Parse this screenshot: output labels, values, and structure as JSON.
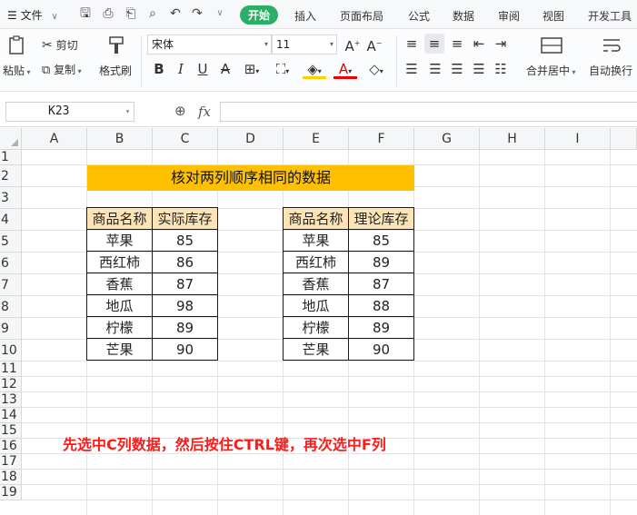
{
  "menubar": {
    "file_label": "文件",
    "tabs": [
      "开始",
      "插入",
      "页面布局",
      "公式",
      "数据",
      "审阅",
      "视图",
      "开发工具"
    ],
    "active_tab": "开始"
  },
  "ribbon": {
    "paste": "粘贴",
    "cut": "剪切",
    "copy": "复制",
    "format_painter": "格式刷",
    "font_name": "宋体",
    "font_size": "11",
    "merge_center": "合并居中",
    "wrap_text": "自动换行"
  },
  "formula_bar": {
    "cell_ref": "K23",
    "fx_label": "fx",
    "formula": ""
  },
  "sheet": {
    "columns": [
      "A",
      "B",
      "C",
      "D",
      "E",
      "F",
      "G",
      "H",
      "I"
    ],
    "rows": [
      "1",
      "2",
      "3",
      "4",
      "5",
      "6",
      "7",
      "8",
      "9",
      "10",
      "11",
      "12",
      "13",
      "14",
      "15",
      "16",
      "17",
      "18",
      "19"
    ],
    "title": "核对两列顺序相同的数据",
    "table1": {
      "headers": [
        "商品名称",
        "实际库存"
      ],
      "rows": [
        [
          "苹果",
          "85"
        ],
        [
          "西红柿",
          "86"
        ],
        [
          "香蕉",
          "87"
        ],
        [
          "地瓜",
          "98"
        ],
        [
          "柠檬",
          "89"
        ],
        [
          "芒果",
          "90"
        ]
      ]
    },
    "table2": {
      "headers": [
        "商品名称",
        "理论库存"
      ],
      "rows": [
        [
          "苹果",
          "85"
        ],
        [
          "西红柿",
          "89"
        ],
        [
          "香蕉",
          "87"
        ],
        [
          "地瓜",
          "88"
        ],
        [
          "柠檬",
          "89"
        ],
        [
          "芒果",
          "90"
        ]
      ]
    },
    "instruction": "先选中C列数据，然后按住CTRL键，再次选中F列"
  },
  "colors": {
    "accent_tab": "#2bae66",
    "title_fill": "#ffc000",
    "header_fill": "#fce4b6",
    "instruction_text": "#ff1a1a"
  }
}
